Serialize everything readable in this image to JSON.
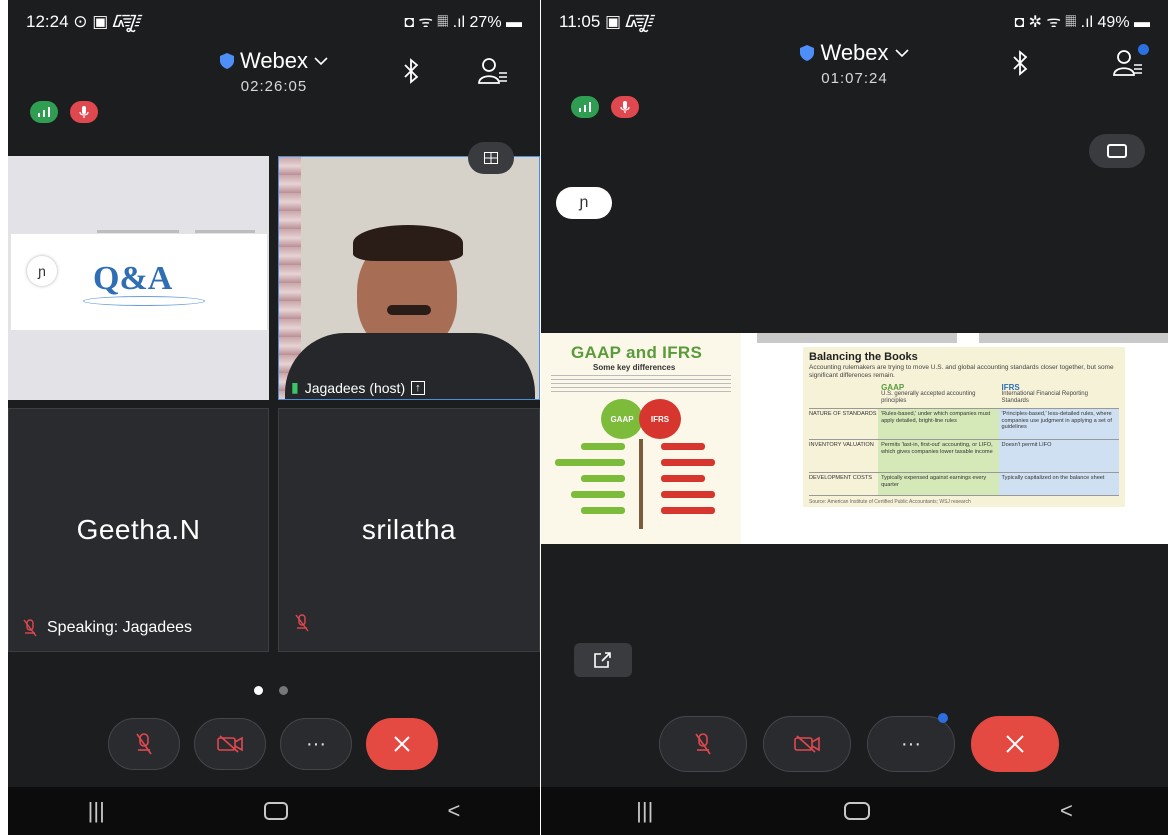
{
  "left": {
    "status": {
      "time": "12:24 ⊙ ▣ ᳄",
      "right": "◘ ᯤ 𝄜 .ıl 27% ▬"
    },
    "meeting": {
      "title": "Webex",
      "timer": "02:26:05"
    },
    "share_slide": {
      "title": "Q&A"
    },
    "tiles": [
      {
        "name": "Jagadees (host)"
      },
      {
        "name": "Geetha.N",
        "speaking": "Speaking: Jagadees"
      },
      {
        "name": "srilatha"
      }
    ],
    "page_dots": [
      true,
      false
    ]
  },
  "right": {
    "status": {
      "time": "11:05 ▣ ᳄",
      "right": "◘ ✲ ᯤ 𝄜 .ıl 49% ▬"
    },
    "meeting": {
      "title": "Webex",
      "timer": "01:07:24"
    },
    "annotation_badge": "ɲ",
    "slide": {
      "left_title": "GAAP and IFRS",
      "left_subtitle": "Some key differences",
      "apple_left": "GAAP",
      "apple_right": "IFRS",
      "heading": "Balancing the Books",
      "intro": "Accounting rulemakers are trying to move U.S. and global accounting standards closer together, but some significant differences remain.",
      "col1_title": "GAAP",
      "col1_sub": "U.S. generally accepted accounting principles",
      "col2_title": "IFRS",
      "col2_sub": "International Financial Reporting Standards",
      "rows": [
        {
          "label": "NATURE OF STANDARDS",
          "gaap": "'Rules-based,' under which companies must apply detailed, bright-line rules",
          "ifrs": "'Principles-based,' less-detailed rules, where companies use judgment in applying a set of guidelines"
        },
        {
          "label": "INVENTORY VALUATION",
          "gaap": "Permits 'last-in, first-out' accounting, or LIFO, which gives companies lower taxable income",
          "ifrs": "Doesn't permit LIFO"
        },
        {
          "label": "DEVELOPMENT COSTS",
          "gaap": "Typically expensed against earnings every quarter",
          "ifrs": "Typically capitalized on the balance sheet"
        }
      ],
      "source": "Source: American Institute of Certified Public Accountants; WSJ research"
    }
  },
  "colors": {
    "end_call": "#e54a42",
    "accent_blue": "#2b6fe0",
    "signal_green": "#2f9e52",
    "mute_red": "#e0484f",
    "bg": "#1c1d1f"
  },
  "icons": [
    "shield-icon",
    "chevron-down-icon",
    "bluetooth-icon",
    "participants-icon",
    "layout-grid-icon",
    "mic-off-icon",
    "video-off-icon",
    "more-icon",
    "end-call-icon",
    "share-icon",
    "recents-icon",
    "home-icon",
    "back-icon"
  ]
}
